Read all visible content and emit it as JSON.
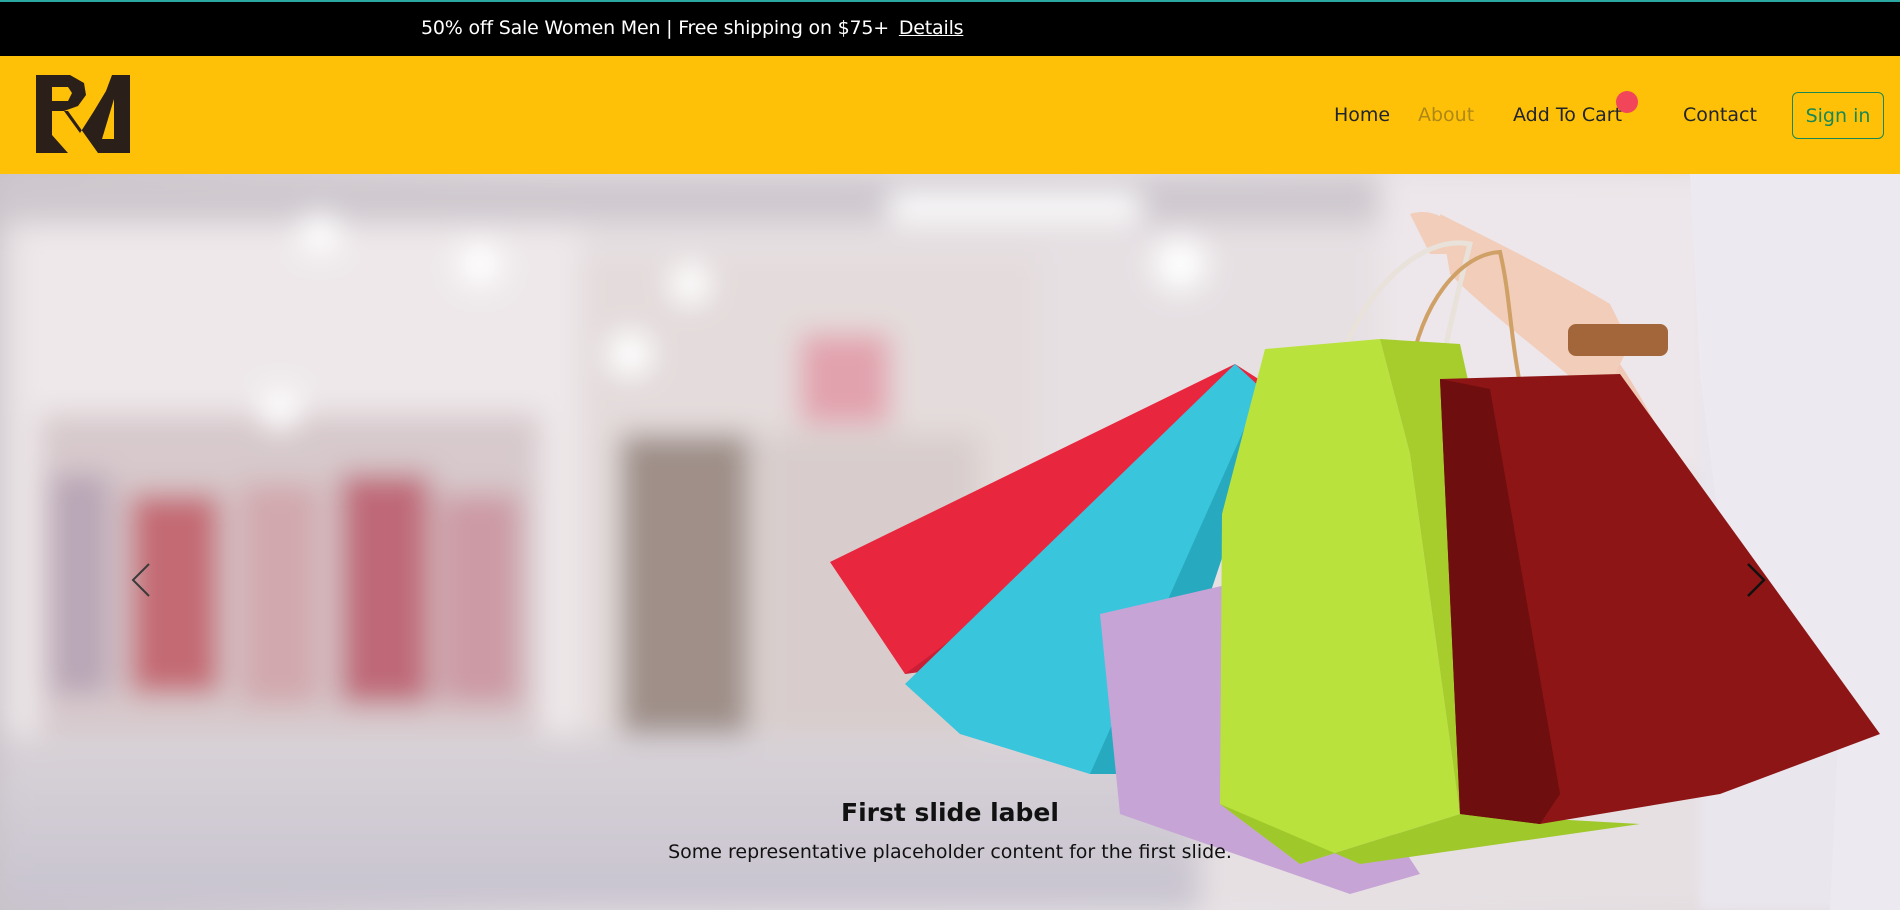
{
  "announcement": {
    "message": "50% off Sale Women Men | Free shipping on $75+",
    "link_label": "Details"
  },
  "navbar": {
    "logo_icon": "rv-monogram-logo",
    "links": [
      "Home",
      "About",
      "Add To Cart",
      "Contact"
    ],
    "active_link": "About",
    "signin_label": "Sign in",
    "colors": {
      "background": "#ffc107",
      "signin_accent": "#198754",
      "cart_badge": "#f2455a"
    }
  },
  "carousel": {
    "prev_icon": "chevron-left-icon",
    "next_icon": "chevron-right-icon",
    "slide": {
      "title": "First slide label",
      "text": "Some representative placeholder content for the first slide."
    }
  }
}
